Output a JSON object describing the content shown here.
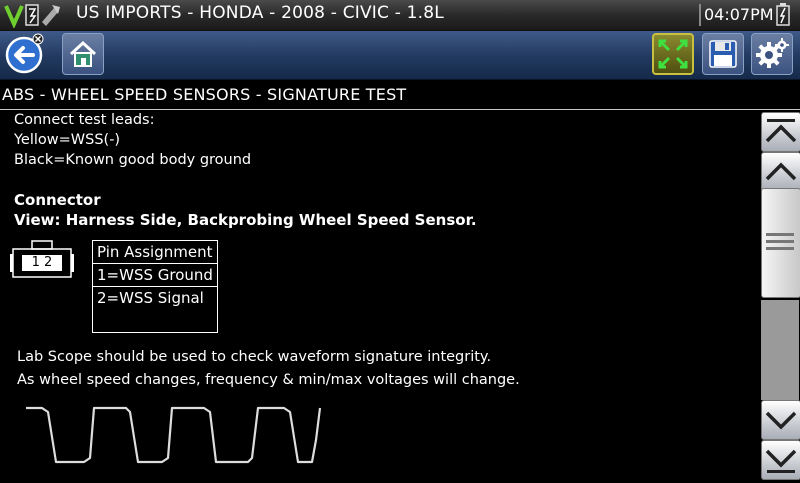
{
  "titlebar": {
    "vehicle_title": "US IMPORTS - HONDA - 2008 - CIVIC - 1.8L",
    "clock": "04:07PM",
    "logo_icon": "snap-on-logo-icon",
    "battery_icon": "battery-icon"
  },
  "toolbar": {
    "back_icon": "back-arrow-icon",
    "home_icon": "home-icon",
    "fullscreen_icon": "fullscreen-toggle-icon",
    "save_icon": "floppy-disk-icon",
    "settings_icon": "gear-icon",
    "accent_color": "#c8c040"
  },
  "page": {
    "heading": "ABS - WHEEL SPEED SENSORS - SIGNATURE TEST"
  },
  "content": {
    "lead_intro": "Connect test leads:",
    "lead_yellow": "Yellow=WSS(-)",
    "lead_black": "Black=Known good body ground",
    "connector_title": "Connector",
    "connector_view": "View: Harness Side, Backprobing Wheel Speed Sensor.",
    "connector_pins_label": "1 2",
    "pin_table": {
      "header": "Pin Assignment",
      "rows": [
        "1=WSS Ground",
        "2=WSS Signal"
      ]
    },
    "note_1": "Lab Scope should be used to check waveform signature integrity.",
    "note_2": "As wheel speed changes, frequency & min/max voltages will change."
  },
  "scrollbar": {
    "top_icon": "scroll-to-top-icon",
    "up_icon": "scroll-up-icon",
    "down_icon": "scroll-down-icon",
    "bottom_icon": "scroll-to-bottom-icon"
  }
}
